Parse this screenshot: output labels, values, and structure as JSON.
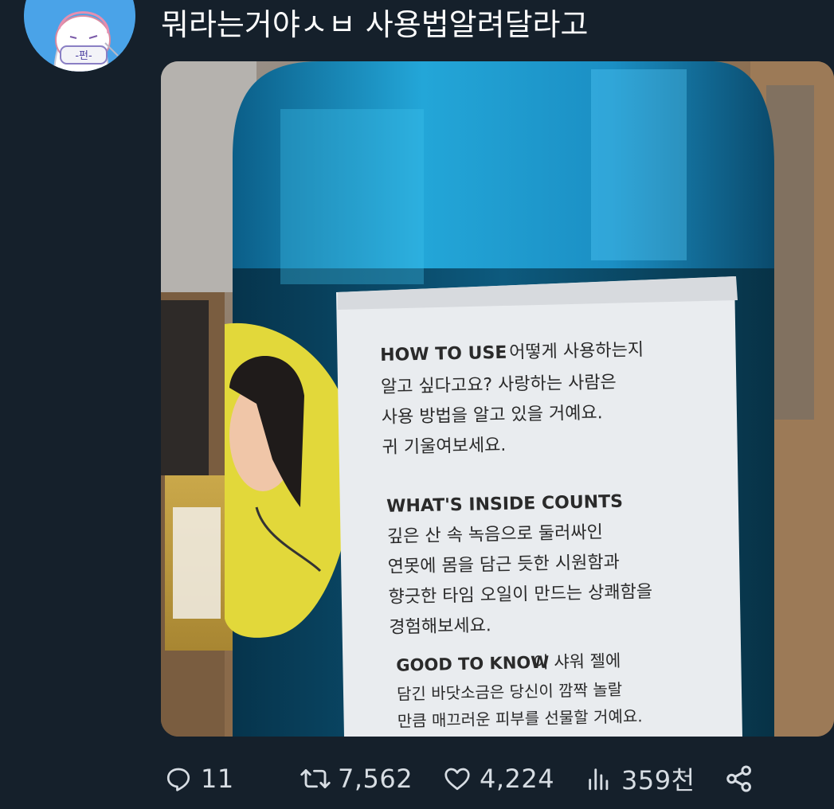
{
  "tweet": {
    "text": "뭐라는거야ㅅㅂ 사용법알려달라고",
    "avatar_icon": "user-avatar-drawing"
  },
  "media": {
    "description_visible_text": {
      "how_to_use_heading": "HOW TO USE",
      "how_to_use_line1": "어떻게 사용하는지",
      "how_to_use_line2": "알고 싶다고요? 사랑하는 사람은",
      "how_to_use_line3": "사용 방법을 알고 있을 거예요.",
      "how_to_use_line4": "귀 기울여보세요.",
      "inside_heading": "WHAT'S INSIDE COUNTS",
      "inside_line1": "깊은 산 속 녹음으로 둘러싸인",
      "inside_line2": "연못에 몸을 담근 듯한 시원함과",
      "inside_line3": "향긋한 타임 오일이 만드는 상쾌함을",
      "inside_line4": "경험해보세요.",
      "good_heading": "GOOD TO KNOW",
      "good_line1": "이 샤워 젤에",
      "good_line2": "담긴 바닷소금은 당신이 깜짝 놀랄",
      "good_line3": "만큼 매끄러운 피부를 선물할 거예요."
    }
  },
  "actions": {
    "reply": {
      "icon": "reply-icon",
      "count": "11"
    },
    "retweet": {
      "icon": "retweet-icon",
      "count": "7,562"
    },
    "like": {
      "icon": "heart-icon",
      "count": "4,224"
    },
    "views": {
      "icon": "views-chart-icon",
      "count": "359천"
    },
    "share": {
      "icon": "share-icon"
    }
  },
  "colors": {
    "background": "#15202b",
    "text": "#ffffff",
    "action_text": "#d7dde3"
  }
}
